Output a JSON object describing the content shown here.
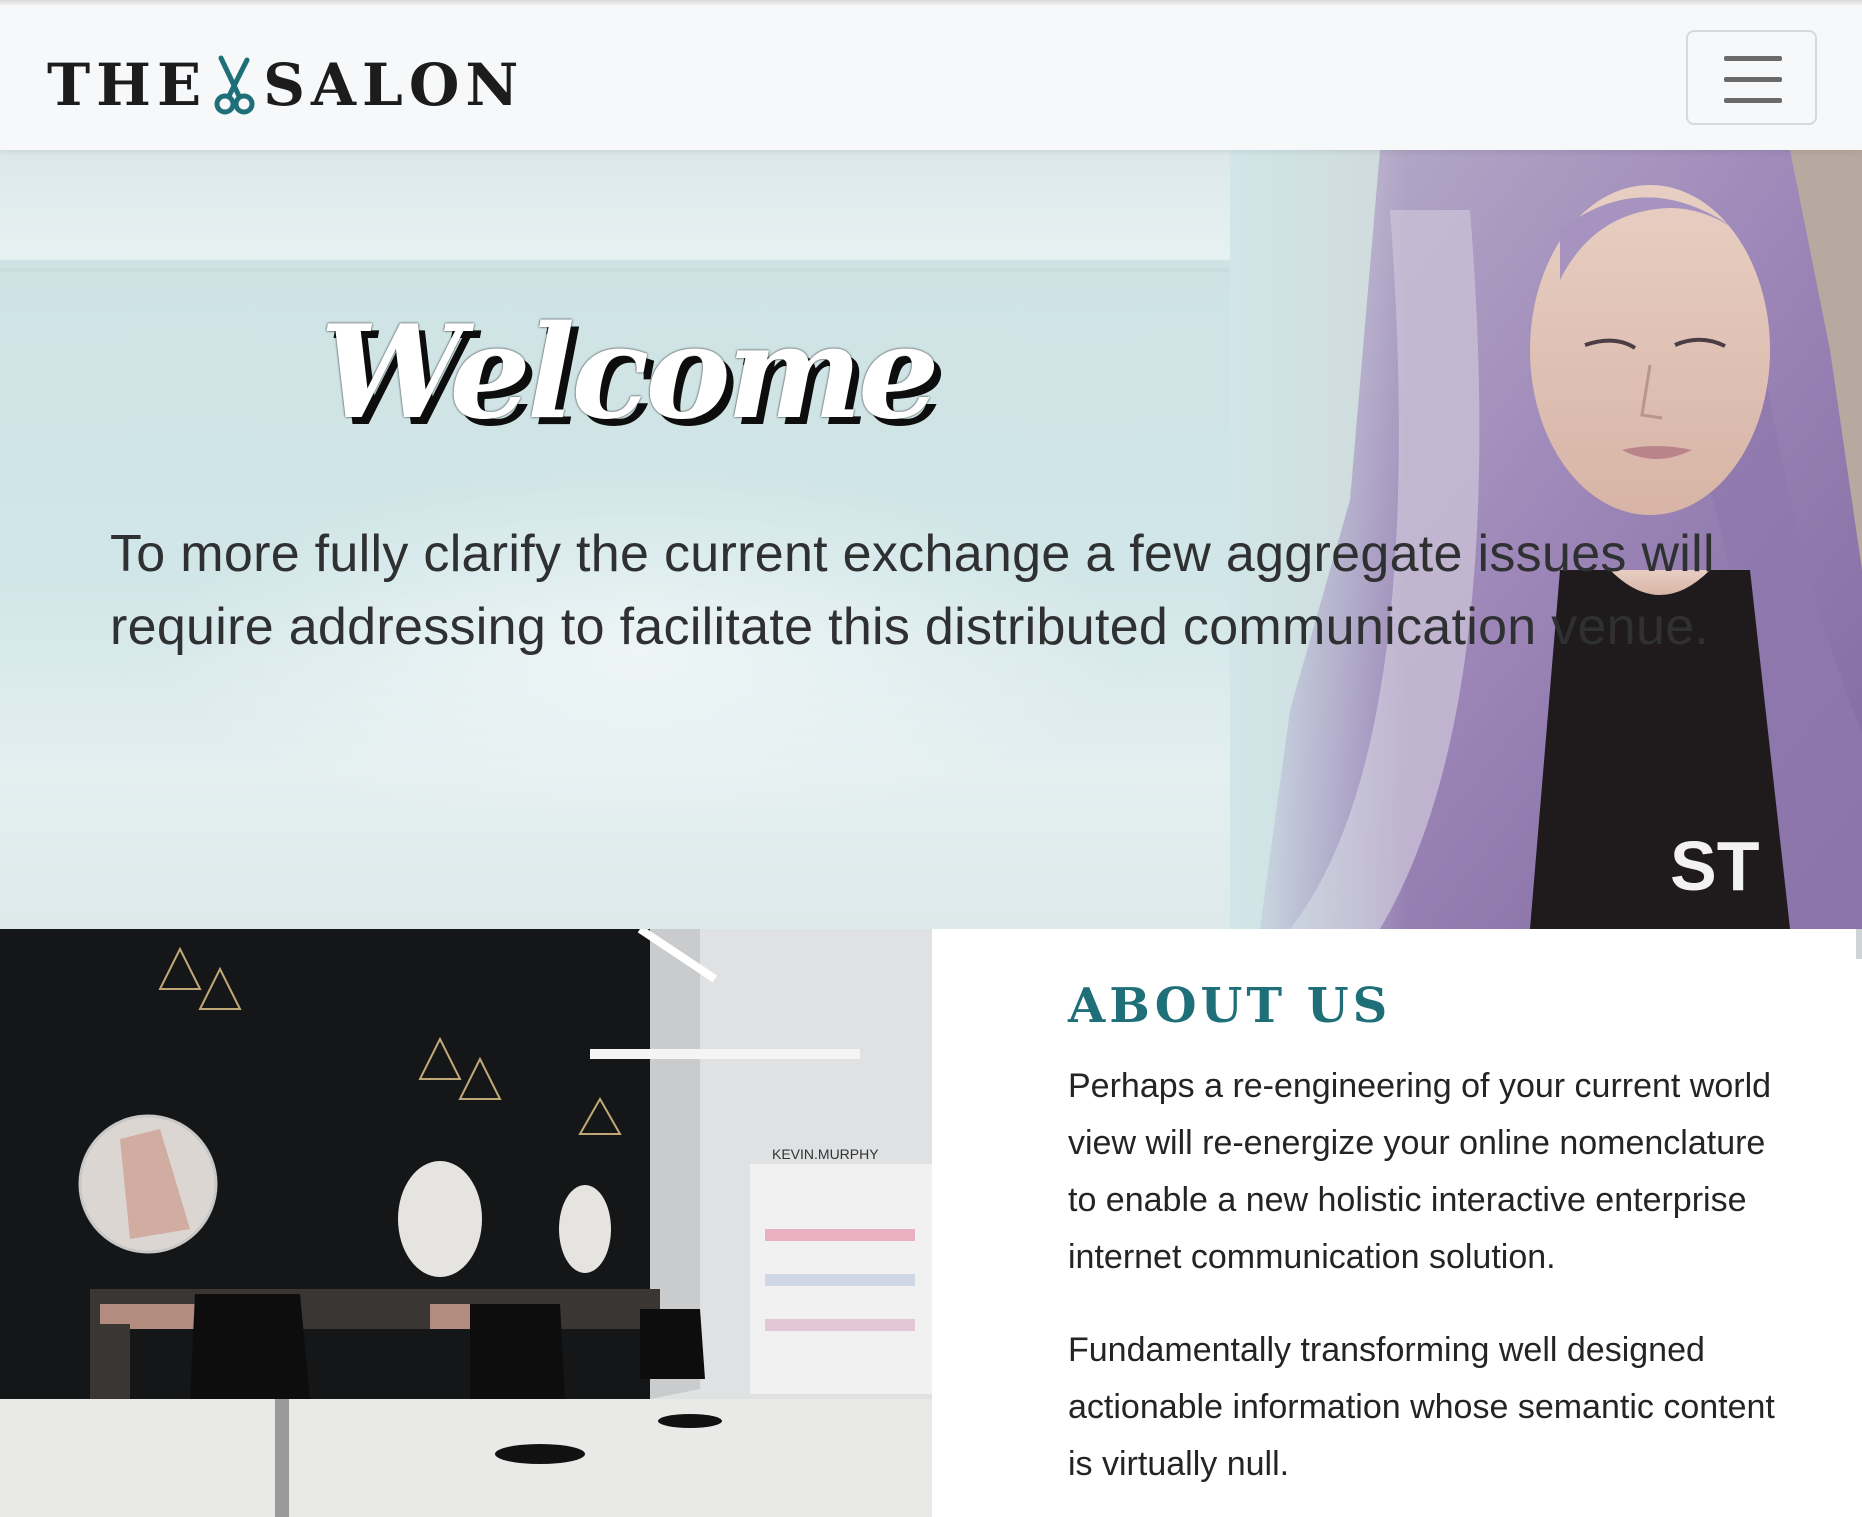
{
  "navbar": {
    "brand_left": "THE",
    "brand_right": "SALON",
    "brand_icon": "scissors-icon",
    "brand_accent_color": "#1f6f78",
    "menu_icon": "hamburger-menu-icon"
  },
  "hero": {
    "heading": "Welcome",
    "text": "To more fully clarify the current exchange a few aggregate issues will require addressing to facilitate this distributed communication venue.",
    "image": "woman-with-lavender-hair-photo"
  },
  "about": {
    "image": "salon-interior-photo",
    "title": "ABOUT US",
    "title_color": "#1f6f78",
    "paragraphs": [
      "Perhaps a re-engineering of your current world view will re-energize your online nomenclature to enable a new holistic interactive enterprise internet communication solution.",
      "Fundamentally transforming well designed actionable information whose semantic content is virtually null."
    ]
  }
}
